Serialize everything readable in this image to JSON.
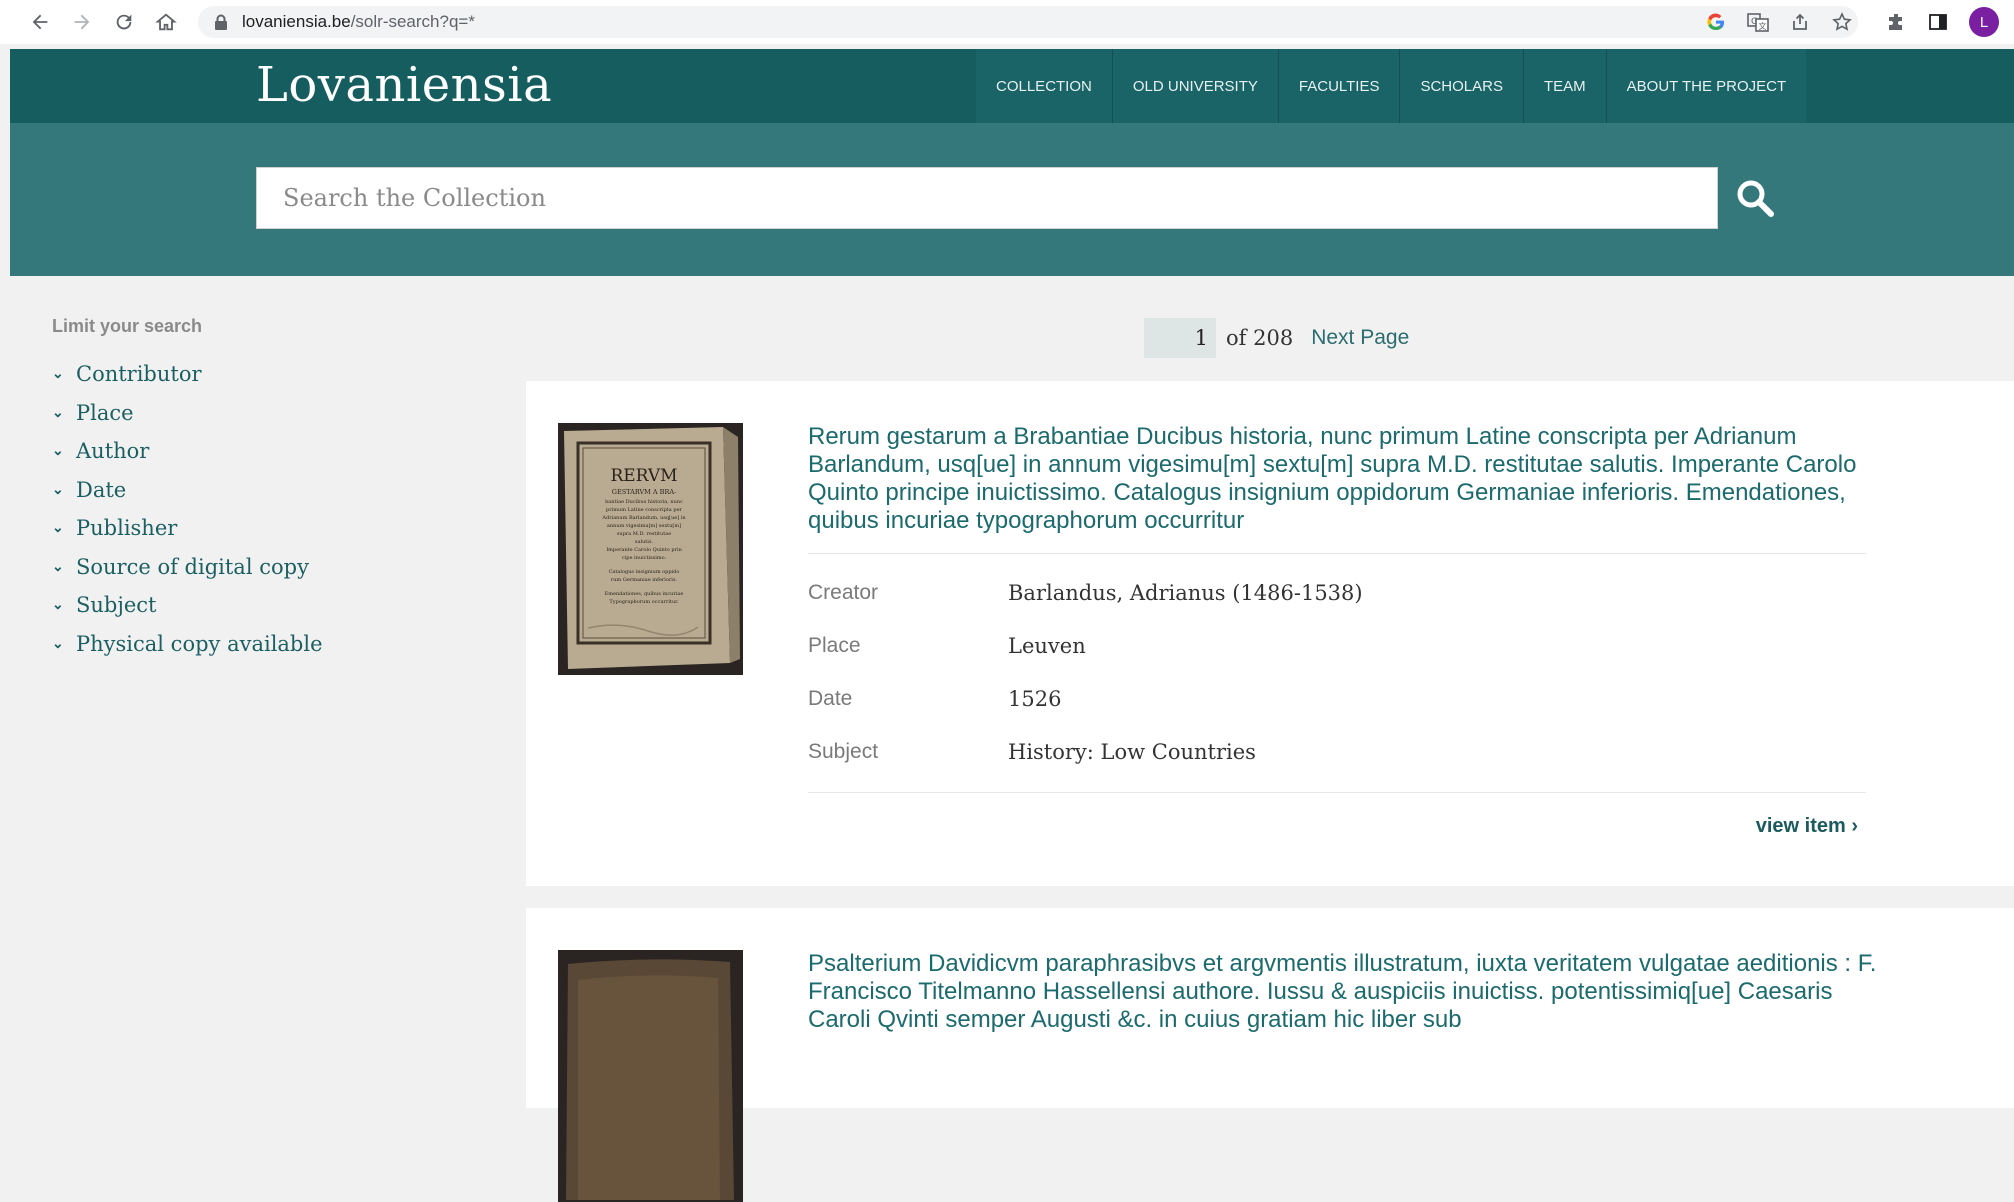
{
  "browser": {
    "url_domain": "lovaniensia.be",
    "url_path": "/solr-search?q=*",
    "avatar_letter": "L",
    "icons": [
      "back-icon",
      "forward-icon",
      "reload-icon",
      "home-icon",
      "lock-icon",
      "google-icon",
      "translate-icon",
      "share-icon",
      "star-icon",
      "extensions-icon",
      "sidepanel-icon"
    ]
  },
  "site": {
    "logo": "Lovaniensia",
    "nav": [
      "COLLECTION",
      "OLD UNIVERSITY",
      "FACULTIES",
      "SCHOLARS",
      "TEAM",
      "ABOUT THE PROJECT"
    ],
    "search_placeholder": "Search the Collection"
  },
  "sidebar": {
    "heading": "Limit your search",
    "facets": [
      "Contributor",
      "Place",
      "Author",
      "Date",
      "Publisher",
      "Source of digital copy",
      "Subject",
      "Physical copy available"
    ]
  },
  "pager": {
    "current": "1",
    "of_text": "of 208",
    "next": "Next Page"
  },
  "results": [
    {
      "title": "Rerum gestarum a Brabantiae Ducibus historia, nunc primum Latine conscripta per Adrianum Barlandum, usq[ue] in annum vigesimu[m] sextu[m] supra M.D. restitutae salutis. Imperante Carolo Quinto principe inuictissimo. Catalogus insignium oppidorum Germaniae inferioris. Emendationes, quibus incuriae typographorum occurritur",
      "fields": [
        {
          "label": "Creator",
          "value": "Barlandus, Adrianus (1486-1538)"
        },
        {
          "label": "Place",
          "value": "Leuven"
        },
        {
          "label": "Date",
          "value": "1526"
        },
        {
          "label": "Subject",
          "value": "History: Low Countries"
        }
      ],
      "view_link": "view item",
      "thumb_text": [
        "RERVM",
        "GESTARVM A BRA-",
        "bantiae Ducibus historia, nunc",
        "primum Latine conscripta per",
        "Adrianum Barlandum, usq[ue] in",
        "annum vigesimu[m] sextu[m]",
        "supra M.D. restitutae",
        "salutis.",
        "Imperante Carolo Quinto prin",
        "cipe inuictissimo.",
        "Catalogus insignium oppido",
        "rum Germaniae inferioris.",
        "Emendationes, quibus incuriae",
        "Typographorum occurritur."
      ]
    },
    {
      "title": "Psalterium Davidicvm paraphrasibvs et argvmentis illustratum, iuxta veritatem vulgatae aeditionis : F. Francisco Titelmanno Hassellensi authore. Iussu & auspiciis inuictiss. potentissimiq[ue] Caesaris Caroli Qvinti semper Augusti &c. in cuius gratiam hic liber sub"
    }
  ]
}
